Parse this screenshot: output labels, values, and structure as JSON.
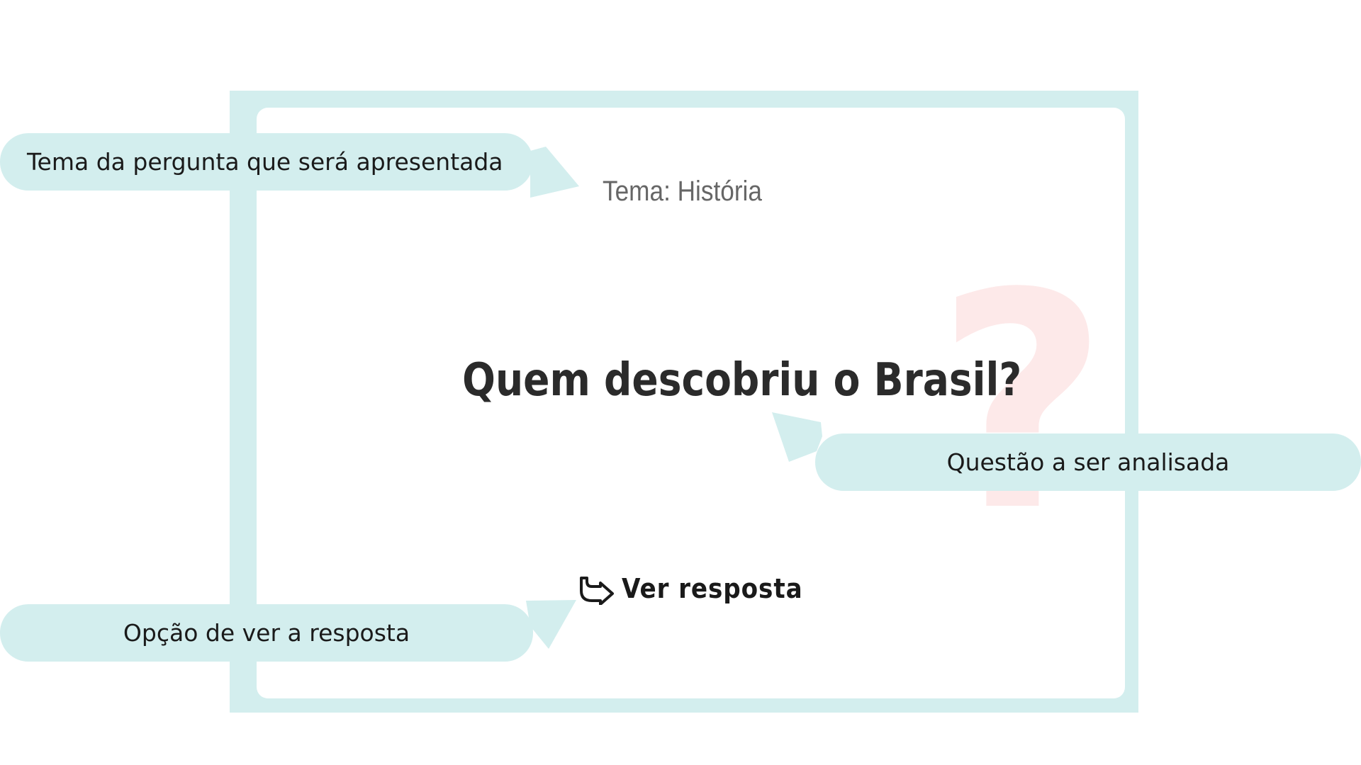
{
  "card": {
    "theme_label": "Tema: História",
    "question": "Quem descobriu o Brasil?",
    "decoration_icon": "question-mark-icon",
    "answer": {
      "icon": "share-arrow-icon",
      "label": "Ver resposta"
    }
  },
  "callouts": {
    "theme": "Tema da pergunta que será apresentada",
    "question": "Questão a ser analisada",
    "answer": "Opção de ver a resposta"
  },
  "colors": {
    "callout_bg": "#d3eeee",
    "frame": "#d3eeee",
    "question_text": "#2b2b2b",
    "theme_text": "#666666",
    "decoration": "#fde9e9"
  }
}
